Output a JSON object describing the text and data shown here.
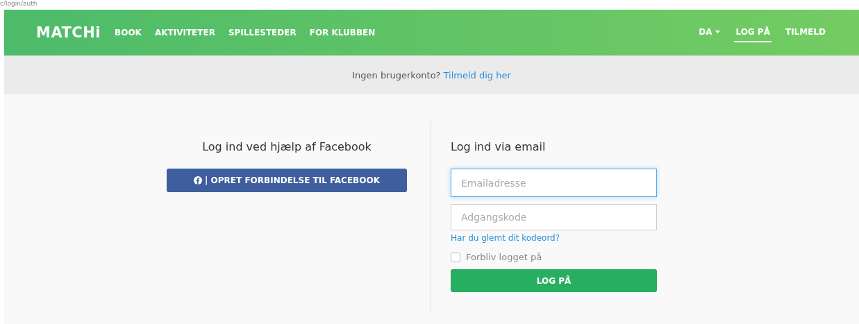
{
  "address_fragment": "c/login/auth",
  "nav": {
    "logo": "MATCHi",
    "links": [
      {
        "label": "BOOK"
      },
      {
        "label": "AKTIVITETER"
      },
      {
        "label": "SPILLESTEDER"
      },
      {
        "label": "FOR KLUBBEN"
      }
    ],
    "right": [
      {
        "kind": "dropdown",
        "label": "DA",
        "selected": false
      },
      {
        "kind": "link",
        "label": "LOG PÅ",
        "selected": true
      },
      {
        "kind": "link",
        "label": "TILMELD",
        "selected": false
      }
    ]
  },
  "banner": {
    "text": "Ingen brugerkonto?",
    "link": "Tilmeld dig her"
  },
  "facebook": {
    "heading": "Log ind ved hjælp af Facebook",
    "button": "| OPRET FORBINDELSE TIL FACEBOOK"
  },
  "email_login": {
    "heading": "Log ind via email",
    "email": {
      "placeholder": "Emailadresse",
      "focused": true
    },
    "password": {
      "placeholder": "Adgangskode",
      "focused": false
    },
    "forgot": "Har du glemt dit kodeord?",
    "remember": {
      "label": "Forbliv logget på",
      "checked": false
    },
    "submit": "LOG PÅ"
  }
}
